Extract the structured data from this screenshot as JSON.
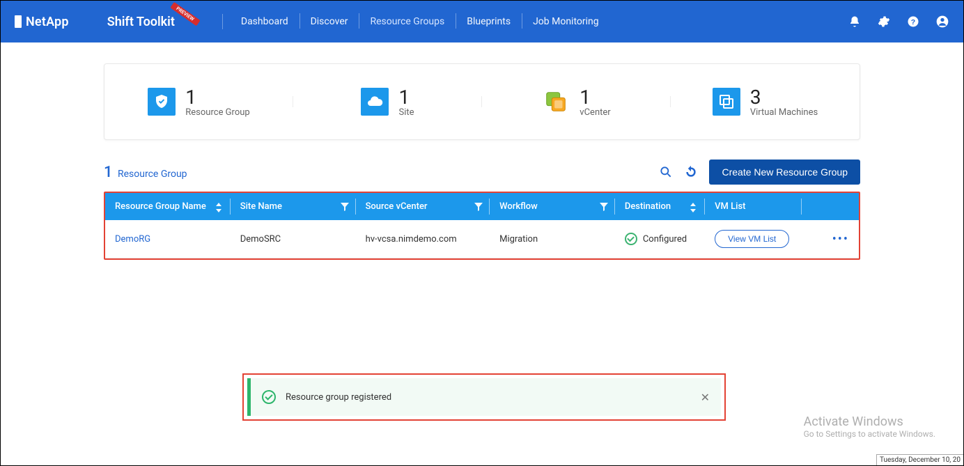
{
  "header": {
    "brand": "NetApp",
    "product": "Shift Toolkit",
    "badge": "PREVIEW",
    "nav": {
      "dashboard": "Dashboard",
      "discover": "Discover",
      "resource_groups": "Resource Groups",
      "blueprints": "Blueprints",
      "job_monitoring": "Job Monitoring"
    }
  },
  "summary": {
    "resource_group": {
      "count": "1",
      "label": "Resource Group"
    },
    "site": {
      "count": "1",
      "label": "Site"
    },
    "vcenter": {
      "count": "1",
      "label": "vCenter"
    },
    "vms": {
      "count": "3",
      "label": "Virtual Machines"
    }
  },
  "actions": {
    "rg_count_num": "1",
    "rg_count_label": "Resource Group",
    "create_button": "Create New Resource Group"
  },
  "table": {
    "cols": {
      "name": "Resource Group Name",
      "site": "Site Name",
      "vcenter": "Source vCenter",
      "workflow": "Workflow",
      "dest": "Destination",
      "vmlist": "VM List"
    },
    "rows": [
      {
        "name": "DemoRG",
        "site": "DemoSRC",
        "vcenter": "hv-vcsa.nimdemo.com",
        "workflow": "Migration",
        "dest": "Configured",
        "vm_button": "View VM List"
      }
    ]
  },
  "toast": {
    "message": "Resource group registered"
  },
  "watermark": {
    "title": "Activate Windows",
    "sub": "Go to Settings to activate Windows."
  },
  "taskbar_date": "Tuesday, December 10, 20"
}
